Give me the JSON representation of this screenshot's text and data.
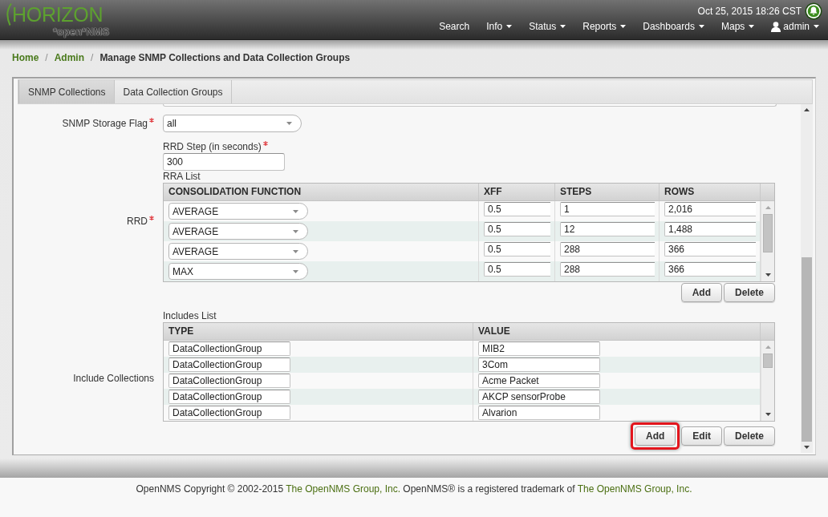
{
  "header": {
    "logo": {
      "title": "HORIZON",
      "subtitle": "*open*NMS"
    },
    "datetime": "Oct 25, 2015 18:26 CST",
    "nav": [
      {
        "label": "Search",
        "kind": "link",
        "dropdown": false
      },
      {
        "label": "Info",
        "kind": "link",
        "dropdown": true
      },
      {
        "label": "Status",
        "kind": "link",
        "dropdown": true
      },
      {
        "label": "Reports",
        "kind": "link",
        "dropdown": true
      },
      {
        "label": "Dashboards",
        "kind": "link",
        "dropdown": true
      },
      {
        "label": "Maps",
        "kind": "link",
        "dropdown": true
      },
      {
        "label": "admin",
        "kind": "user",
        "dropdown": true
      }
    ]
  },
  "breadcrumb": {
    "separator": "/",
    "items": [
      {
        "label": "Home",
        "kind": "link"
      },
      {
        "label": "Admin",
        "kind": "link"
      },
      {
        "label": "Manage SNMP Collections and Data Collection Groups",
        "kind": "current"
      }
    ]
  },
  "tabs": [
    {
      "label": "SNMP Collections",
      "selected": true
    },
    {
      "label": "Data Collection Groups",
      "selected": false
    }
  ],
  "form": {
    "storage_flag": {
      "label": "SNMP Storage Flag",
      "required": true,
      "value": "all"
    },
    "rrd": {
      "label": "RRD",
      "required": true,
      "step": {
        "label": "RRD Step (in seconds)",
        "required": true,
        "value": "300"
      },
      "rra_list": {
        "title": "RRA List",
        "columns": [
          "CONSOLIDATION FUNCTION",
          "XFF",
          "STEPS",
          "ROWS"
        ],
        "rows": [
          {
            "function": "AVERAGE",
            "xff": "0.5",
            "steps": "1",
            "rows": "2,016"
          },
          {
            "function": "AVERAGE",
            "xff": "0.5",
            "steps": "12",
            "rows": "1,488"
          },
          {
            "function": "AVERAGE",
            "xff": "0.5",
            "steps": "288",
            "rows": "366"
          },
          {
            "function": "MAX",
            "xff": "0.5",
            "steps": "288",
            "rows": "366"
          }
        ],
        "buttons": [
          {
            "label": "Add",
            "highlighted": false
          },
          {
            "label": "Delete",
            "highlighted": false
          }
        ]
      }
    },
    "includes": {
      "label": "Include Collections",
      "required": false,
      "list": {
        "title": "Includes List",
        "columns": [
          "TYPE",
          "VALUE"
        ],
        "rows": [
          {
            "type": "DataCollectionGroup",
            "value": "MIB2"
          },
          {
            "type": "DataCollectionGroup",
            "value": "3Com"
          },
          {
            "type": "DataCollectionGroup",
            "value": "Acme Packet"
          },
          {
            "type": "DataCollectionGroup",
            "value": "AKCP sensorProbe"
          },
          {
            "type": "DataCollectionGroup",
            "value": "Alvarion"
          }
        ],
        "buttons": [
          {
            "label": "Add",
            "highlighted": true
          },
          {
            "label": "Edit",
            "highlighted": false
          },
          {
            "label": "Delete",
            "highlighted": false
          }
        ]
      }
    }
  },
  "footer": {
    "parts": [
      {
        "kind": "text",
        "text": "OpenNMS Copyright © 2002-2015"
      },
      {
        "kind": "link",
        "text": "The OpenNMS Group, Inc."
      },
      {
        "kind": "text",
        "text": "OpenNMS® is a registered trademark of"
      },
      {
        "kind": "link",
        "text": "The OpenNMS Group, Inc."
      }
    ]
  }
}
